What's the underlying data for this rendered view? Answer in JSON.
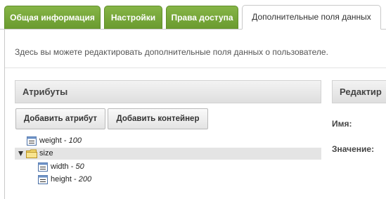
{
  "tabs": [
    {
      "label": "Общая информация",
      "active": false
    },
    {
      "label": "Настройки",
      "active": false
    },
    {
      "label": "Права доступа",
      "active": false
    },
    {
      "label": "Дополнительные поля данных",
      "active": true
    }
  ],
  "intro": "Здесь вы можете редактировать дополнительные поля данных о пользователе.",
  "attributes_panel": {
    "title": "Атрибуты",
    "add_attribute": "Добавить атрибут",
    "add_container": "Добавить контейнер",
    "tree": [
      {
        "name": "weight",
        "value": "100",
        "type": "attribute"
      },
      {
        "name": "size",
        "value": "",
        "type": "container",
        "expanded": true,
        "selected": true
      },
      {
        "name": "width",
        "value": "50",
        "type": "attribute"
      },
      {
        "name": "height",
        "value": "200",
        "type": "attribute"
      }
    ],
    "separator": " - "
  },
  "edit_panel": {
    "title": "Редактир",
    "name_label": "Имя:",
    "value_label": "Значение:"
  },
  "colors": {
    "tab_green": "#7aa93c",
    "selected_row": "#e4e4e4"
  }
}
